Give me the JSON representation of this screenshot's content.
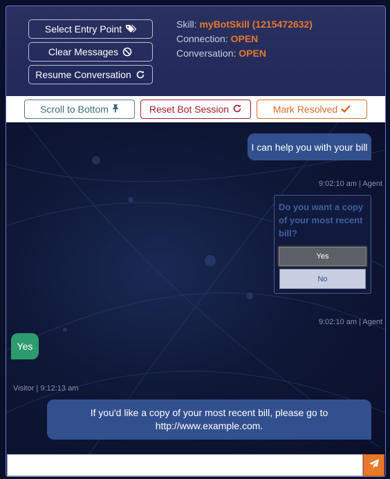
{
  "header": {
    "buttons": [
      {
        "label": "Select Entry Point",
        "icon": "tags-icon"
      },
      {
        "label": "Clear Messages",
        "icon": "ban-icon"
      },
      {
        "label": "Resume Conversation",
        "icon": "refresh-icon"
      }
    ],
    "skill_label": "Skill:",
    "skill_value": "myBotSkill (1215472632)",
    "connection_label": "Connection:",
    "connection_value": "OPEN",
    "conversation_label": "Conversation:",
    "conversation_value": "OPEN"
  },
  "toolbar": {
    "scroll_label": "Scroll to Bottom",
    "reset_label": "Reset Bot Session",
    "resolve_label": "Mark Resolved"
  },
  "messages": {
    "agent_1": "I can help you with your bill",
    "ts_1": "9:02:10 am | Agent",
    "card_question": "Do you want a copy of your most recent bill?",
    "card_yes": "Yes",
    "card_no": "No",
    "ts_2": "9:02:10 am | Agent",
    "visitor_1": "Yes",
    "ts_3": "Visitor | 9:12:13 am",
    "agent_2": "If you'd like a copy of your most recent bill, please go to http://www.example.com."
  },
  "composer": {
    "placeholder": "",
    "value": ""
  },
  "colors": {
    "accent": "#e8782a",
    "agent_bubble": "#33508e",
    "visitor_bubble": "#2e9b6e"
  }
}
